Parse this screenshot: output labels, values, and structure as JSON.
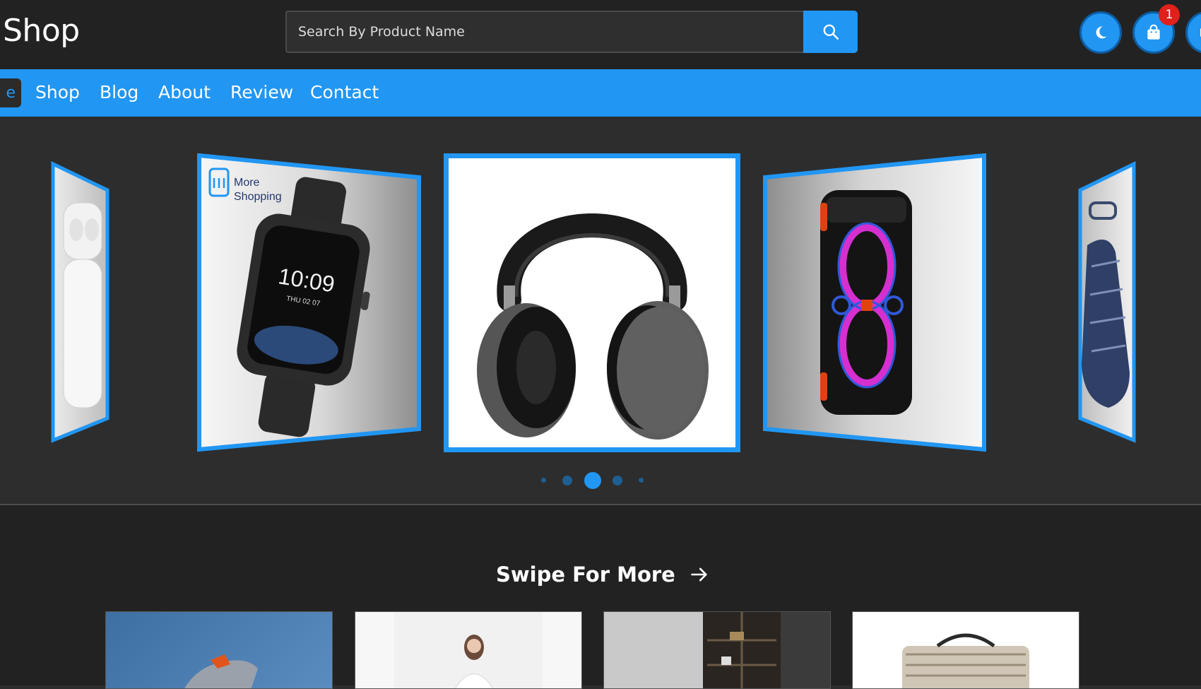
{
  "header": {
    "brand": "Shop",
    "search": {
      "placeholder": "Search By Product Name"
    },
    "cart_badge": "1"
  },
  "nav": {
    "home_label_partial": "e",
    "items": [
      "Shop",
      "Blog",
      "About",
      "Review",
      "Contact"
    ]
  },
  "carousel": {
    "slides": [
      {
        "name": "airpods"
      },
      {
        "name": "smartwatch",
        "brand_text_1": "More",
        "brand_text_2": "Shopping",
        "watch_time": "10:09",
        "watch_date": "THU 02 07"
      },
      {
        "name": "headphones"
      },
      {
        "name": "party-speaker"
      },
      {
        "name": "portable-speaker"
      }
    ],
    "dots_count": 5,
    "active_dot": 2
  },
  "section": {
    "title": "Swipe For More",
    "cards": [
      "sneaker",
      "model",
      "interior",
      "bag"
    ]
  },
  "colors": {
    "accent": "#2196f3",
    "header_bg": "#222222",
    "page_bg": "#2d2d2d",
    "badge": "#e0201b"
  }
}
